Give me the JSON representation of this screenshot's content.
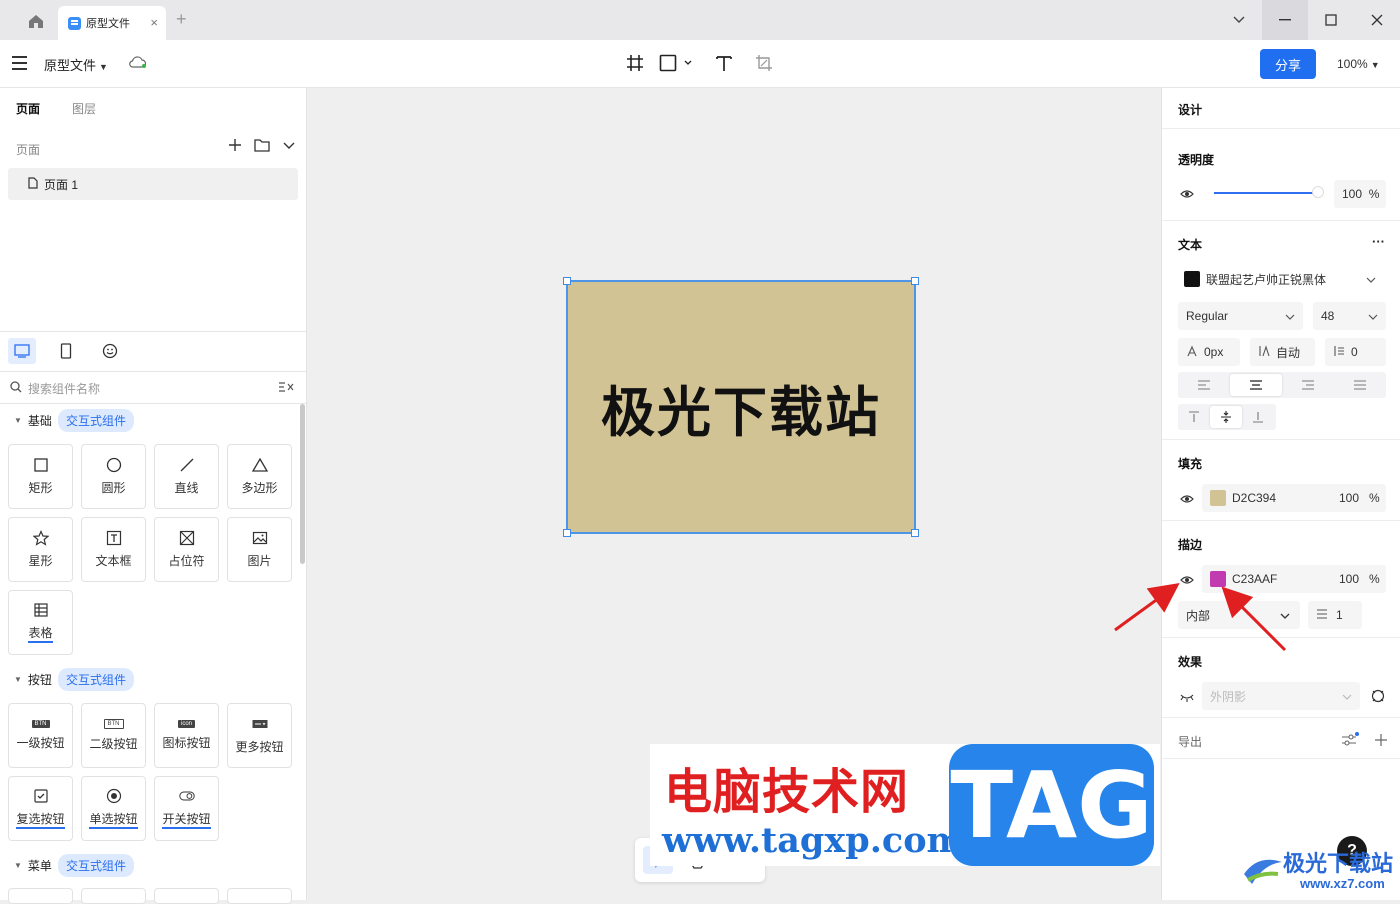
{
  "tabbar": {
    "tab_title": "原型文件",
    "close": "×",
    "add": "+"
  },
  "toolbar": {
    "file_name": "原型文件",
    "share_label": "分享",
    "zoom": "100%"
  },
  "left_panel": {
    "tabs": [
      {
        "label": "页面"
      },
      {
        "label": "图层"
      }
    ],
    "pages_header": "页面",
    "page_item": "页面 1",
    "search_placeholder": "搜索组件名称",
    "sections": [
      {
        "title": "基础",
        "badge": "交互式组件",
        "items": [
          "矩形",
          "圆形",
          "直线",
          "多边形",
          "星形",
          "文本框",
          "占位符",
          "图片",
          "表格"
        ]
      },
      {
        "title": "按钮",
        "badge": "交互式组件",
        "items": [
          "一级按钮",
          "二级按钮",
          "图标按钮",
          "更多按钮",
          "复选按钮",
          "单选按钮",
          "开关按钮"
        ]
      },
      {
        "title": "菜单",
        "badge": "交互式组件"
      }
    ],
    "btn_icon_labels": {
      "primary": "BTN",
      "secondary": "BTN",
      "icon": "icon"
    }
  },
  "canvas": {
    "artboard_text": "极光下载站",
    "fill_color": "#d2c394"
  },
  "right_panel": {
    "design": "设计",
    "opacity": {
      "title": "透明度",
      "value": "100",
      "unit": "%"
    },
    "text": {
      "title": "文本",
      "more": "···",
      "font": "联盟起艺卢帅正锐黑体",
      "weight": "Regular",
      "size": "48",
      "letter_spacing": "0px",
      "line_height": "自动",
      "paragraph": "0"
    },
    "fill": {
      "title": "填充",
      "hex": "D2C394",
      "opacity": "100",
      "unit": "%",
      "color": "#d2c394"
    },
    "stroke": {
      "title": "描边",
      "hex": "C23AAF",
      "opacity": "100",
      "unit": "%",
      "color": "#c23aaf",
      "position": "内部",
      "width": "1"
    },
    "effect": {
      "title": "效果",
      "shadow": "外阴影"
    },
    "export": {
      "title": "导出"
    }
  },
  "help": "?",
  "watermark": {
    "cn": "电脑技术网",
    "url": "www.tagxp.com",
    "tag": "TAG",
    "site": "极光下载站",
    "site_url": "www.xz7.com"
  }
}
